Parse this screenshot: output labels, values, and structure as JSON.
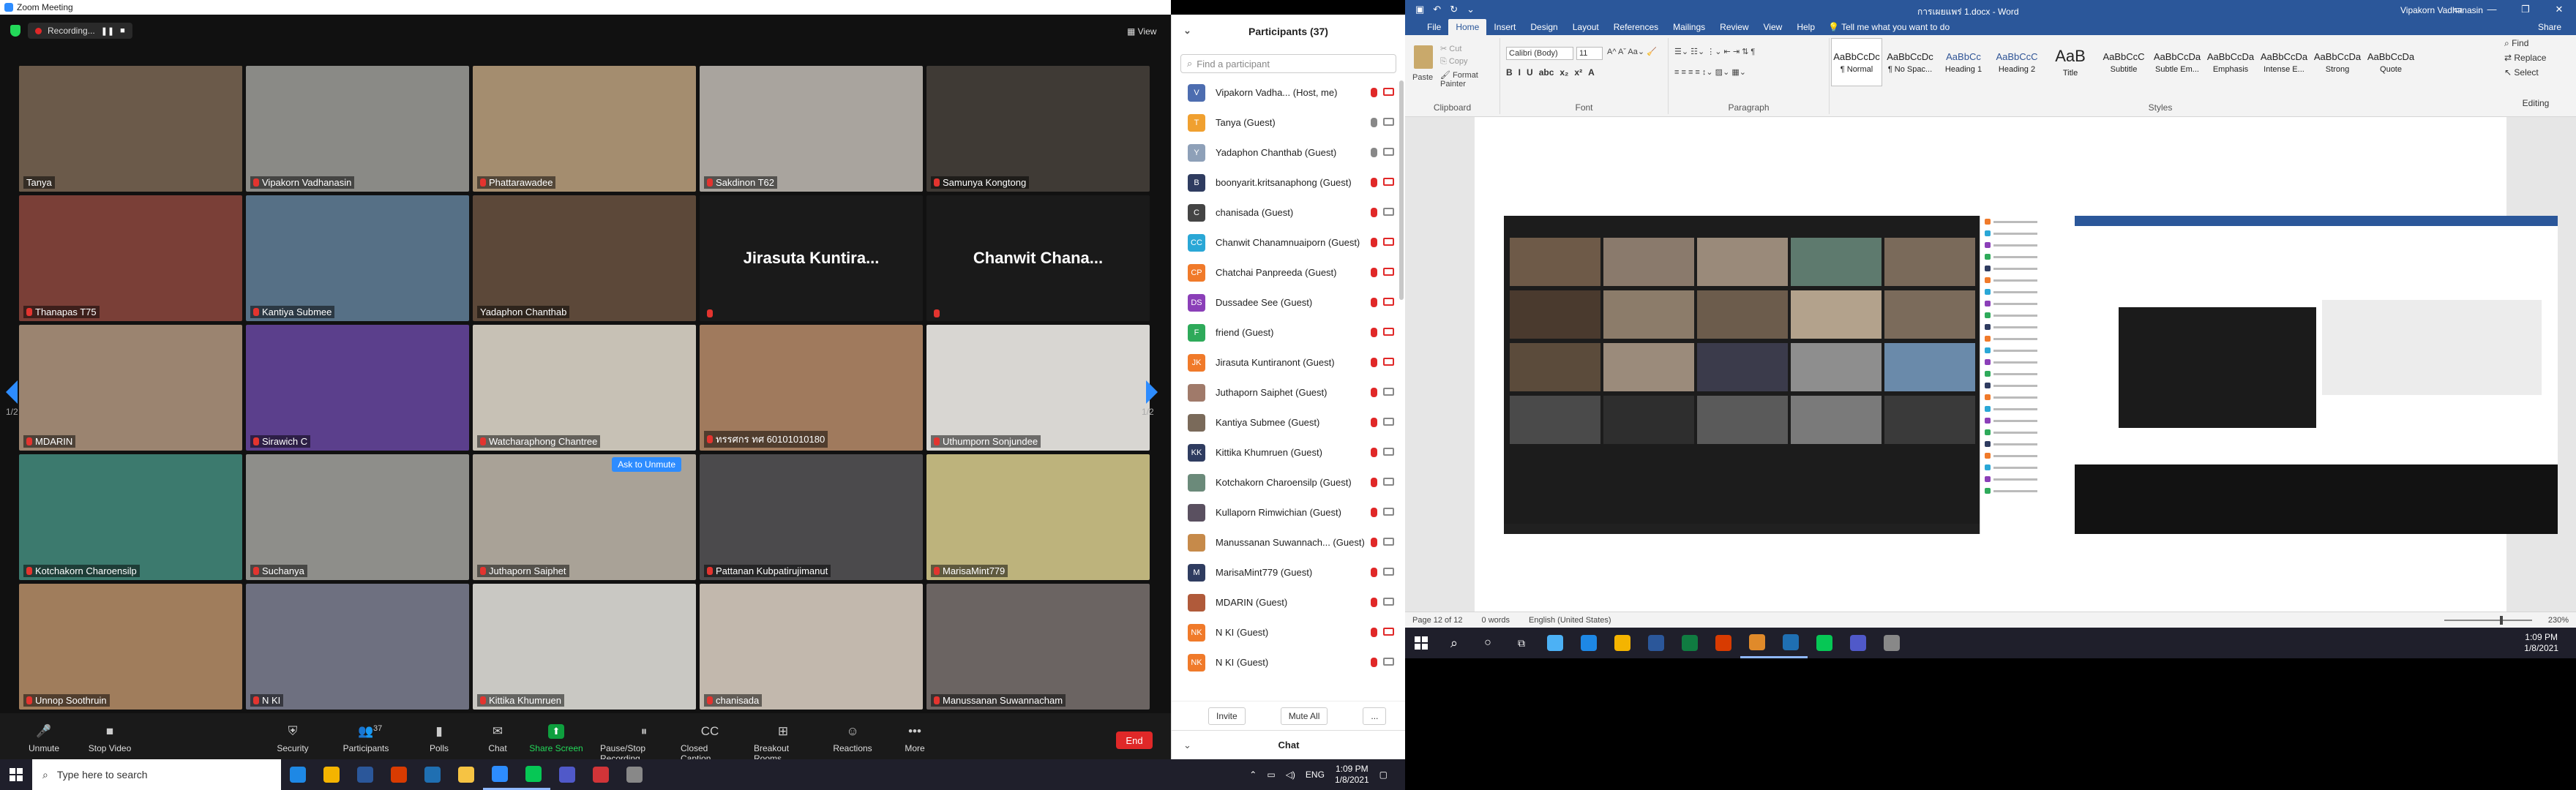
{
  "zoom": {
    "window_title": "Zoom Meeting",
    "recording_label": "Recording...",
    "view_label": "View",
    "page_left": "1/2",
    "page_right": "1/2",
    "ask_to_unmute": "Ask to Unmute",
    "tiles": [
      {
        "name": "Tanya",
        "color": "#6b5a4a",
        "active": true,
        "muted": false
      },
      {
        "name": "Vipakorn Vadhanasin",
        "color": "#8a8a86",
        "muted": true
      },
      {
        "name": "Phattarawadee",
        "color": "#a48d6f",
        "muted": true
      },
      {
        "name": "Sakdinon T62",
        "color": "#a9a49e",
        "muted": true
      },
      {
        "name": "Samunya Kongtong",
        "color": "#3f3a35",
        "muted": true
      },
      {
        "name": "Thanapas T75",
        "color": "#7a3f37",
        "muted": true
      },
      {
        "name": "Kantiya Submee",
        "color": "#567086",
        "muted": true
      },
      {
        "name": "Yadaphon Chanthab",
        "color": "#5c4839",
        "muted": false
      },
      {
        "name": "",
        "big": "Jirasuta Kuntira...",
        "color": "#1a1a1a",
        "muted": true
      },
      {
        "name": "",
        "big": "Chanwit Chana...",
        "color": "#1a1a1a",
        "muted": true
      },
      {
        "name": "MDARIN",
        "color": "#9b8470",
        "muted": true
      },
      {
        "name": "Sirawich C",
        "color": "#5b3f8c",
        "muted": true
      },
      {
        "name": "Watcharaphong Chantree",
        "color": "#c7c1b5",
        "muted": true
      },
      {
        "name": "ทรรศกร ทศ 60101010180",
        "color": "#a07a5d",
        "muted": true
      },
      {
        "name": "Uthumporn Sonjundee",
        "color": "#d8d6d2",
        "muted": true
      },
      {
        "name": "Kotchakorn Charoensilp",
        "color": "#3c7a6e",
        "muted": true
      },
      {
        "name": "Suchanya",
        "color": "#8e8e8a",
        "muted": true
      },
      {
        "name": "Juthaporn Saiphet",
        "color": "#a9a297",
        "muted": true,
        "ask": true
      },
      {
        "name": "Pattanan Kubpatirujimanut",
        "color": "#4b4a4c",
        "muted": true
      },
      {
        "name": "MarisaMint779",
        "color": "#bdb37c",
        "muted": true
      },
      {
        "name": "Unnop Soothruin",
        "color": "#a07d5c",
        "muted": true
      },
      {
        "name": "N KI",
        "color": "#6e7080",
        "muted": true
      },
      {
        "name": "Kittika Khumruen",
        "color": "#c9c8c3",
        "muted": true
      },
      {
        "name": "chanisada",
        "color": "#c2b8ad",
        "muted": true
      },
      {
        "name": "Manussanan Suwannacham",
        "color": "#6b6462",
        "muted": true
      }
    ],
    "toolbar": [
      {
        "label": "Unmute",
        "icon": "🎤"
      },
      {
        "label": "Stop Video",
        "icon": "■"
      },
      {
        "label": "Security",
        "icon": "⛨"
      },
      {
        "label": "Participants",
        "icon": "👥",
        "count": "37"
      },
      {
        "label": "Polls",
        "icon": "▮"
      },
      {
        "label": "Chat",
        "icon": "✉"
      },
      {
        "label": "Share Screen",
        "icon": "⬆",
        "green": true
      },
      {
        "label": "Pause/Stop Recording",
        "icon": "⏸"
      },
      {
        "label": "Closed Caption",
        "icon": "CC"
      },
      {
        "label": "Breakout Rooms",
        "icon": "⊞"
      },
      {
        "label": "Reactions",
        "icon": "☺"
      },
      {
        "label": "More",
        "icon": "•••"
      }
    ],
    "end_label": "End"
  },
  "participants": {
    "title": "Participants (37)",
    "search_placeholder": "Find a participant",
    "invite": "Invite",
    "mute_all": "Mute All",
    "more": "...",
    "chat_title": "Chat",
    "list": [
      {
        "name": "Vipakorn Vadha...    (Host, me)",
        "av": "V",
        "color": "#4d6db0",
        "mic": false,
        "cam": false
      },
      {
        "name": "Tanya (Guest)",
        "av": "T",
        "color": "#f0a030",
        "mic": true,
        "cam": true
      },
      {
        "name": "Yadaphon Chanthab (Guest)",
        "av": "Y",
        "color": "#8ea0b8",
        "mic": true,
        "cam": true
      },
      {
        "name": "boonyarit.kritsanaphong (Guest)",
        "av": "B",
        "color": "#2f3c60",
        "mic": false,
        "cam": false
      },
      {
        "name": "chanisada (Guest)",
        "av": "C",
        "color": "#444",
        "mic": false,
        "cam": true
      },
      {
        "name": "Chanwit Chanamnuaiporn (Guest)",
        "av": "CC",
        "color": "#2aa7d6",
        "mic": false,
        "cam": false
      },
      {
        "name": "Chatchai Panpreeda (Guest)",
        "av": "CP",
        "color": "#f07a2a",
        "mic": false,
        "cam": false
      },
      {
        "name": "Dussadee See (Guest)",
        "av": "DS",
        "color": "#8b3fb8",
        "mic": false,
        "cam": false
      },
      {
        "name": "friend (Guest)",
        "av": "F",
        "color": "#2eaa5a",
        "mic": false,
        "cam": false
      },
      {
        "name": "Jirasuta Kuntiranont (Guest)",
        "av": "JK",
        "color": "#f07a2a",
        "mic": false,
        "cam": false
      },
      {
        "name": "Juthaporn Saiphet (Guest)",
        "av": "",
        "color": "#a07a6a",
        "mic": false,
        "cam": true
      },
      {
        "name": "Kantiya Submee (Guest)",
        "av": "",
        "color": "#7a6a5a",
        "mic": false,
        "cam": true
      },
      {
        "name": "Kittika Khumruen (Guest)",
        "av": "KK",
        "color": "#2f3c60",
        "mic": false,
        "cam": true
      },
      {
        "name": "Kotchakorn Charoensilp (Guest)",
        "av": "",
        "color": "#6b8a7a",
        "mic": false,
        "cam": true
      },
      {
        "name": "Kullaporn Rimwichian (Guest)",
        "av": "",
        "color": "#5a5060",
        "mic": false,
        "cam": true
      },
      {
        "name": "Manussanan Suwannach... (Guest)",
        "av": "",
        "color": "#c68a4a",
        "mic": false,
        "cam": true
      },
      {
        "name": "MarisaMint779 (Guest)",
        "av": "M",
        "color": "#2f3c60",
        "mic": false,
        "cam": true
      },
      {
        "name": "MDARIN (Guest)",
        "av": "",
        "color": "#b05a3a",
        "mic": false,
        "cam": true
      },
      {
        "name": "N KI (Guest)",
        "av": "NK",
        "color": "#f07a2a",
        "mic": false,
        "cam": false
      },
      {
        "name": "N KI (Guest)",
        "av": "NK",
        "color": "#f07a2a",
        "mic": false,
        "cam": true
      }
    ]
  },
  "taskbar_left": {
    "search_placeholder": "Type here to search",
    "apps": [
      "#1e88e5",
      "#f4b400",
      "#2b579a",
      "#d83b01",
      "#1f6fb2",
      "#f6c343",
      "#2d8cff",
      "#06c755",
      "#5059c9",
      "#d13438",
      "#888"
    ],
    "lang": "ENG",
    "time": "1:09 PM",
    "date": "1/8/2021"
  },
  "word": {
    "doc_title": "การเผยแพร่ 1.docx  -  Word",
    "user": "Vipakorn Vadhanasin",
    "tabs": [
      "File",
      "Home",
      "Insert",
      "Design",
      "Layout",
      "References",
      "Mailings",
      "Review",
      "View",
      "Help"
    ],
    "selected_tab": "Home",
    "tell_me": "Tell me what you want to do",
    "share": "Share",
    "clipboard": {
      "paste": "Paste",
      "cut": "Cut",
      "copy": "Copy",
      "format_painter": "Format Painter",
      "label": "Clipboard"
    },
    "font": {
      "name": "Calibri (Body)",
      "size": "11",
      "label": "Font",
      "buttons": [
        "B",
        "I",
        "U",
        "abc",
        "x₂",
        "x²",
        "A"
      ]
    },
    "paragraph_label": "Paragraph",
    "styles_label": "Styles",
    "styles": [
      {
        "sample": "AaBbCcDc",
        "label": "¶ Normal",
        "sel": true
      },
      {
        "sample": "AaBbCcDc",
        "label": "¶ No Spac..."
      },
      {
        "sample": "AaBbCc",
        "label": "Heading 1"
      },
      {
        "sample": "AaBbCcC",
        "label": "Heading 2"
      },
      {
        "sample": "AaB",
        "label": "Title"
      },
      {
        "sample": "AaBbCcC",
        "label": "Subtitle"
      },
      {
        "sample": "AaBbCcDa",
        "label": "Subtle Em..."
      },
      {
        "sample": "AaBbCcDa",
        "label": "Emphasis"
      },
      {
        "sample": "AaBbCcDa",
        "label": "Intense E..."
      },
      {
        "sample": "AaBbCcDa",
        "label": "Strong"
      },
      {
        "sample": "AaBbCcDa",
        "label": "Quote"
      }
    ],
    "editing": {
      "find": "Find",
      "replace": "Replace",
      "select": "Select",
      "label": "Editing"
    },
    "status": {
      "page": "Page 12 of 12",
      "words": "0 words",
      "lang": "English (United States)",
      "zoom": "230%"
    }
  },
  "taskbar_right": {
    "apps": [
      "#4cb1f5",
      "#1e88e5",
      "#f4b400",
      "#2b579a",
      "#107c41",
      "#d83b01",
      "#e08a2a",
      "#1f6fb2",
      "#06c755",
      "#5059c9",
      "#888"
    ],
    "time": "1:09 PM",
    "date": "1/8/2021"
  }
}
